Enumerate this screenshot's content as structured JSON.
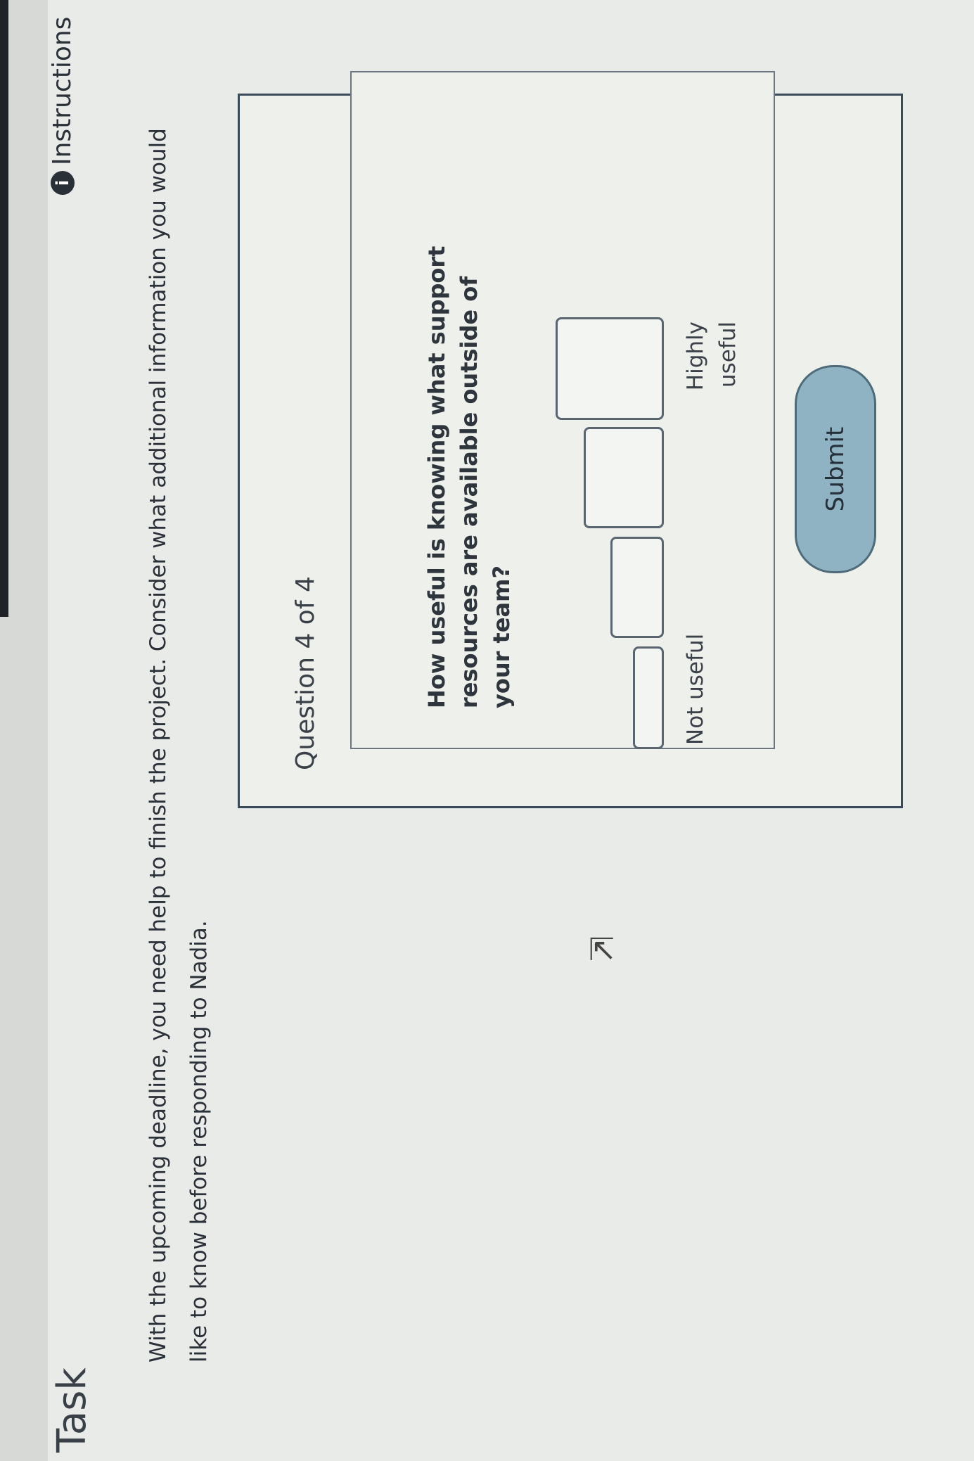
{
  "header": {
    "page_title": "Task",
    "instructions_label": "Instructions",
    "instructions_icon": "info-icon"
  },
  "prompt": "With the upcoming deadline, you need help to finish the project. Consider what additional information you would like to know before responding to Nadia.",
  "question": {
    "number_label": "Question 4 of 4",
    "text": "How useful is knowing what support resources are available outside of your team?",
    "scale": {
      "min_label": "Not useful",
      "max_label": "Highly useful",
      "options_count": 4,
      "selected": null
    }
  },
  "submit_label": "Submit",
  "colors": {
    "panel_border": "#3b4a58",
    "submit_bg": "#8fb3c3",
    "info_icon": "#2a3038"
  }
}
